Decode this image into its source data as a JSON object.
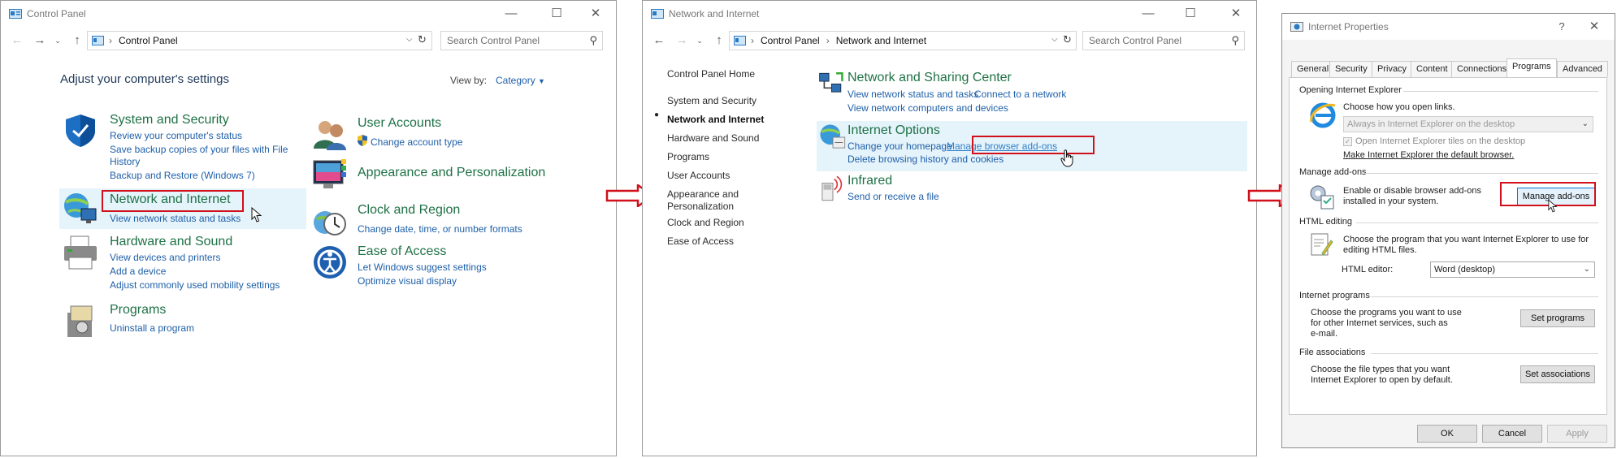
{
  "cp": {
    "title": "Control Panel",
    "crumbs": [
      "Control Panel"
    ],
    "search_placeholder": "Search Control Panel",
    "heading": "Adjust your computer's settings",
    "viewby_label": "View by:",
    "viewby_value": "Category",
    "categories": {
      "system": {
        "title": "System and Security",
        "links": [
          "Review your computer's status",
          "Save backup copies of your files with File",
          "History",
          "Backup and Restore (Windows 7)"
        ]
      },
      "network": {
        "title": "Network and Internet",
        "links": [
          "View network status and tasks"
        ]
      },
      "hardware": {
        "title": "Hardware and Sound",
        "links": [
          "View devices and printers",
          "Add a device",
          "Adjust commonly used mobility settings"
        ]
      },
      "programs": {
        "title": "Programs",
        "links": [
          "Uninstall a program"
        ]
      },
      "users": {
        "title": "User Accounts",
        "links": [
          "Change account type"
        ]
      },
      "appearance": {
        "title": "Appearance and Personalization",
        "links": []
      },
      "clock": {
        "title": "Clock and Region",
        "links": [
          "Change date, time, or number formats"
        ]
      },
      "ease": {
        "title": "Ease of Access",
        "links": [
          "Let Windows suggest settings",
          "Optimize visual display"
        ]
      }
    }
  },
  "ni": {
    "title": "Network and Internet",
    "crumbs": [
      "Control Panel",
      "Network and Internet"
    ],
    "search_placeholder": "Search Control Panel",
    "sidebar": [
      "Control Panel Home",
      "System and Security",
      "Network and Internet",
      "Hardware and Sound",
      "Programs",
      "User Accounts",
      "Appearance and",
      "Personalization",
      "Clock and Region",
      "Ease of Access"
    ],
    "sections": {
      "sharing": {
        "title": "Network and Sharing Center",
        "links": [
          "View network status and tasks",
          "Connect to a network",
          "View network computers and devices"
        ]
      },
      "options": {
        "title": "Internet Options",
        "links": [
          "Change your homepage",
          "Manage browser add-ons",
          "Delete browsing history and cookies"
        ]
      },
      "infrared": {
        "title": "Infrared",
        "links": [
          "Send or receive a file"
        ]
      }
    }
  },
  "ip": {
    "title": "Internet Properties",
    "help": "?",
    "tabs": [
      "General",
      "Security",
      "Privacy",
      "Content",
      "Connections",
      "Programs",
      "Advanced"
    ],
    "selected_tab": "Programs",
    "open_ie": {
      "group": "Opening Internet Explorer",
      "desc": "Choose how you open links.",
      "combo": "Always in Internet Explorer on the desktop",
      "checkbox": "Open Internet Explorer tiles on the desktop",
      "link": "Make Internet Explorer the default browser."
    },
    "addons": {
      "group": "Manage add-ons",
      "desc1": "Enable or disable browser add-ons",
      "desc2": "installed in your system.",
      "button": "Manage add-ons"
    },
    "html": {
      "group": "HTML editing",
      "desc1": "Choose the program that you want Internet Explorer to use for",
      "desc2": "editing HTML files.",
      "label": "HTML editor:",
      "value": "Word (desktop)"
    },
    "programs": {
      "group": "Internet programs",
      "desc1": "Choose the programs you want to use",
      "desc2": "for other Internet services, such as",
      "desc3": "e-mail.",
      "button": "Set programs"
    },
    "files": {
      "group": "File associations",
      "desc1": "Choose the file types that you want",
      "desc2": "Internet Explorer to open by default.",
      "button": "Set associations"
    },
    "ok": "OK",
    "cancel": "Cancel",
    "apply": "Apply"
  },
  "colors": {
    "accent_red": "#d0101a",
    "link": "#1e5fa8",
    "category": "#1e7145",
    "highlight": "#e5f3fb"
  }
}
